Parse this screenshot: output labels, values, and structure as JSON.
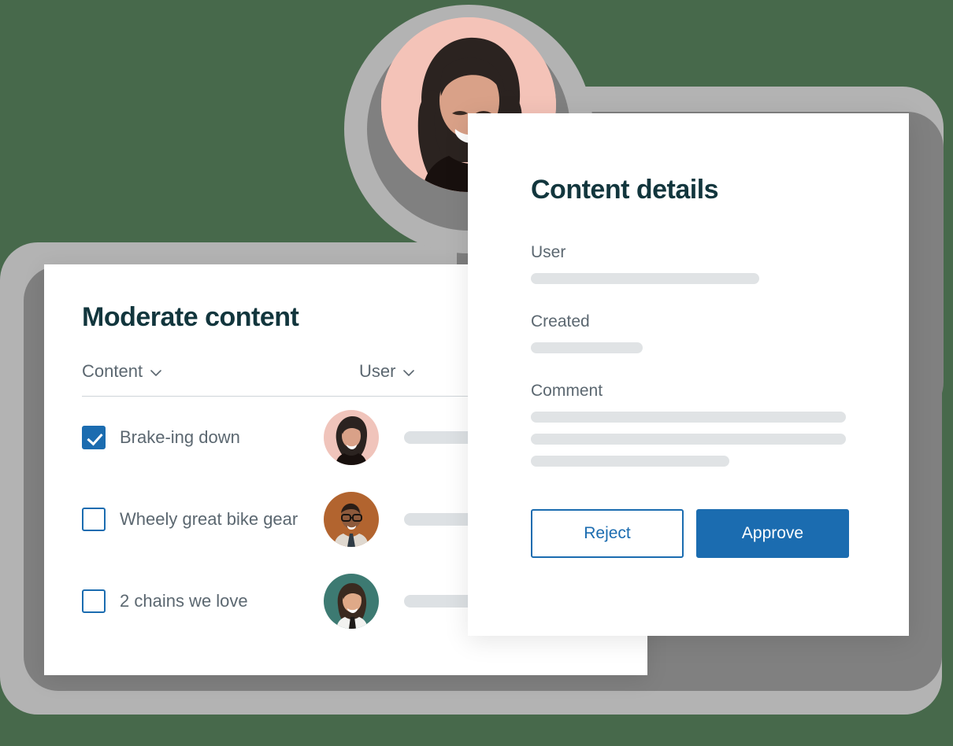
{
  "theme": {
    "background_green": "#47694b",
    "layer_light_gray": "#b3b3b3",
    "layer_dark_gray": "#808080",
    "accent_blue": "#1b6cb0",
    "heading_teal": "#12363d",
    "body_gray": "#5b6770",
    "placeholder_gray": "#e0e3e5"
  },
  "moderate_card": {
    "title": "Moderate content",
    "columns": [
      {
        "label": "Content",
        "icon": "chevron-down-icon"
      },
      {
        "label": "User",
        "icon": "chevron-down-icon"
      }
    ],
    "rows": [
      {
        "label": "Brake-ing down",
        "checked": true,
        "avatar_bg": "#f0c4bb",
        "avatar": "avatar-woman-dark-hair"
      },
      {
        "label": "Wheely great bike gear",
        "checked": false,
        "avatar_bg": "#b2642f",
        "avatar": "avatar-man-glasses"
      },
      {
        "label": "2 chains we love",
        "checked": false,
        "avatar_bg": "#3d7a72",
        "avatar": "avatar-woman-smiling"
      }
    ]
  },
  "details_card": {
    "title": "Content details",
    "fields": [
      {
        "label": "User",
        "bars": [
          290
        ]
      },
      {
        "label": "Created",
        "bars": [
          142
        ]
      },
      {
        "label": "Comment",
        "bars": [
          400,
          400,
          252
        ]
      }
    ],
    "buttons": {
      "reject": "Reject",
      "approve": "Approve"
    }
  },
  "hero": {
    "avatar": "avatar-woman-dark-hair-large",
    "avatar_bg": "#f4c3b8"
  }
}
